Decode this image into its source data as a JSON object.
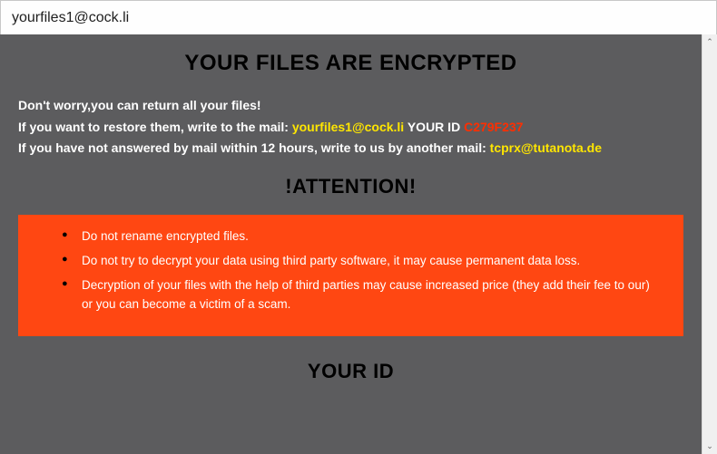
{
  "window": {
    "title": "yourfiles1@cock.li"
  },
  "headings": {
    "main": "YOUR FILES ARE ENCRYPTED",
    "attention": "!ATTENTION!",
    "your_id": "YOUR ID"
  },
  "intro": {
    "line1": "Don't worry,you can return all your files!",
    "line2_prefix": "If you want to restore them, write to the mail: ",
    "email1": "yourfiles1@cock.li",
    "your_id_label": "  YOUR ID ",
    "id_value": "C279F237",
    "line3_prefix": "If you have not answered by mail within 12 hours, write to us by another mail: ",
    "email2": "tcprx@tutanota.de"
  },
  "warnings": [
    "Do not rename encrypted files.",
    "Do not try to decrypt your data using third party software, it may cause permanent data loss.",
    "Decryption of your files with the help of third parties may cause increased price (they add their fee to our) or you can become a victim of a scam."
  ],
  "scrollbar": {
    "up_glyph": "⌃",
    "down_glyph": "⌄"
  },
  "colors": {
    "content_bg": "#5c5c5e",
    "warn_bg": "#ff4712",
    "highlight_yellow": "#ffe600",
    "highlight_red": "#ff2e00"
  }
}
